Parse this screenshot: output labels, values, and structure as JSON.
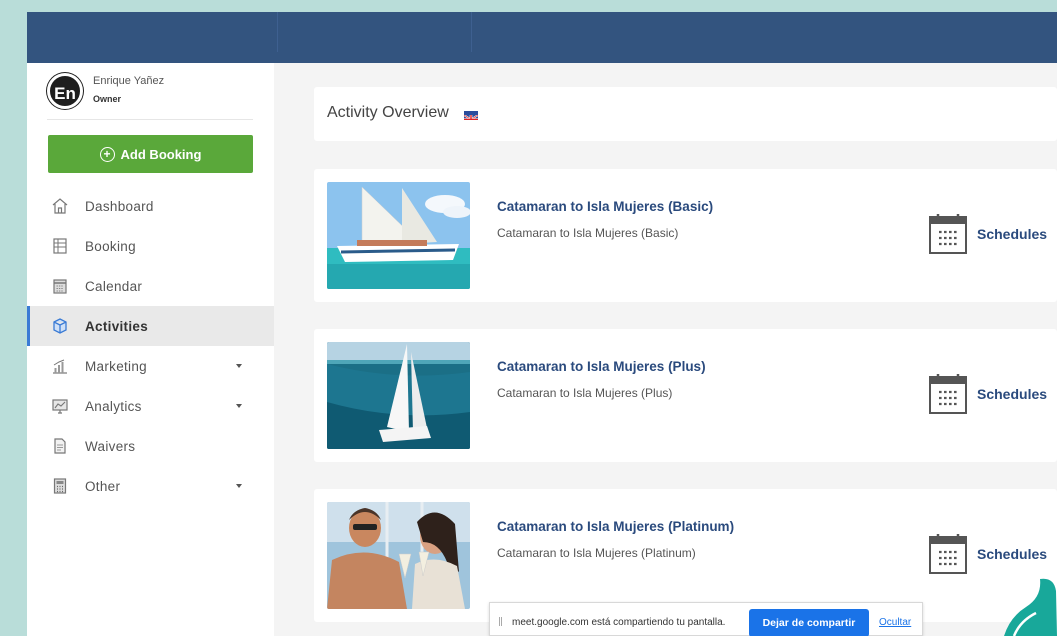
{
  "user": {
    "name": "Enrique Yañez",
    "role": "Owner",
    "avatar_text": "En"
  },
  "actions": {
    "add_booking": "Add Booking"
  },
  "nav": [
    {
      "label": "Dashboard",
      "icon": "home-icon",
      "active": false,
      "has_caret": false
    },
    {
      "label": "Booking",
      "icon": "booking-icon",
      "active": false,
      "has_caret": false
    },
    {
      "label": "Calendar",
      "icon": "calendar-icon",
      "active": false,
      "has_caret": false
    },
    {
      "label": "Activities",
      "icon": "box-icon",
      "active": true,
      "has_caret": false
    },
    {
      "label": "Marketing",
      "icon": "bar-chart-icon",
      "active": false,
      "has_caret": true
    },
    {
      "label": "Analytics",
      "icon": "monitor-chart-icon",
      "active": false,
      "has_caret": true
    },
    {
      "label": "Waivers",
      "icon": "document-icon",
      "active": false,
      "has_caret": false
    },
    {
      "label": "Other",
      "icon": "calculator-icon",
      "active": false,
      "has_caret": true
    }
  ],
  "overview": {
    "title": "Activity Overview",
    "flag": "uk-flag-icon"
  },
  "activities": [
    {
      "title": "Catamaran to Isla Mujeres (Basic)",
      "subtitle": "Catamaran to Isla Mujeres (Basic)",
      "schedules_label": "Schedules",
      "image": "sailboat-photo"
    },
    {
      "title": "Catamaran to Isla Mujeres (Plus)",
      "subtitle": "Catamaran to Isla Mujeres (Plus)",
      "schedules_label": "Schedules",
      "image": "catamaran-aerial-photo"
    },
    {
      "title": "Catamaran to Isla Mujeres (Platinum)",
      "subtitle": "Catamaran to Isla Mujeres (Platinum)",
      "schedules_label": "Schedules",
      "image": "couple-toast-photo"
    }
  ],
  "share_bar": {
    "message": "meet.google.com está compartiendo tu pantalla.",
    "stop_label": "Dejar de compartir",
    "hide_label": "Ocultar"
  },
  "colors": {
    "topbar": "#33547f",
    "accent_green": "#5aa83a",
    "link_blue": "#2a4a7d",
    "share_blue": "#1a73e8",
    "backdrop": "#b9ddd9"
  }
}
